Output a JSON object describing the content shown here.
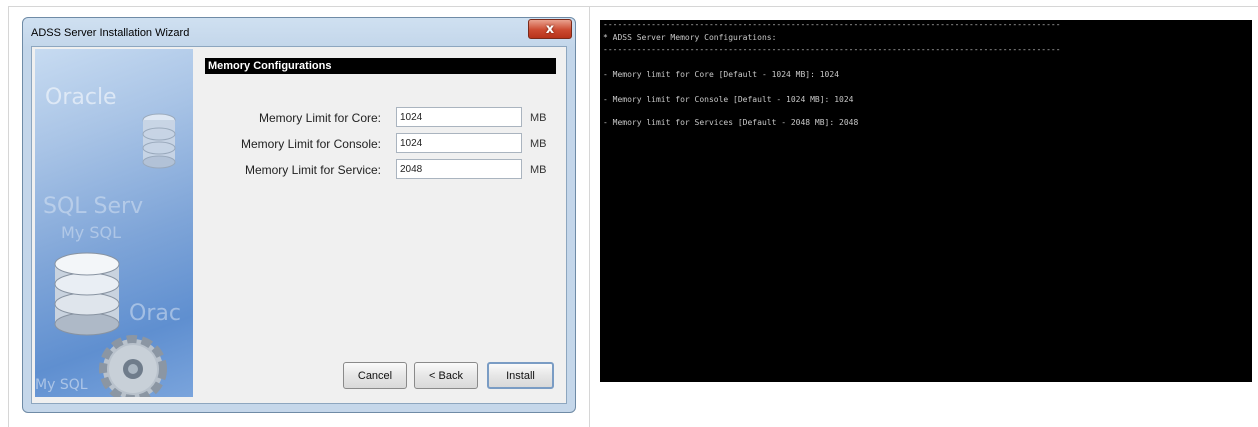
{
  "wizard": {
    "title": "ADSS Server Installation Wizard",
    "close_glyph": "x",
    "watermarks": [
      "Oracle",
      "SQL Serv",
      "My SQL",
      "Orac",
      "My SQL"
    ],
    "panel_heading": "Memory Configurations",
    "rows": [
      {
        "label": "Memory Limit for Core:",
        "value": "1024",
        "unit": "MB"
      },
      {
        "label": "Memory Limit for Console:",
        "value": "1024",
        "unit": "MB"
      },
      {
        "label": "Memory Limit for Service:",
        "value": "2048",
        "unit": "MB"
      }
    ],
    "buttons": {
      "cancel": "Cancel",
      "back": "< Back",
      "install": "Install"
    }
  },
  "console": {
    "separator": "-----------------------------------------------------------------------------------------------",
    "heading": "* ADSS Server Memory Configurations:",
    "lines": [
      "- Memory limit for Core [Default - 1024 MB]: 1024",
      "- Memory limit for Console [Default - 1024 MB]: 1024",
      "- Memory limit for Services [Default - 2048 MB]: 2048"
    ]
  }
}
